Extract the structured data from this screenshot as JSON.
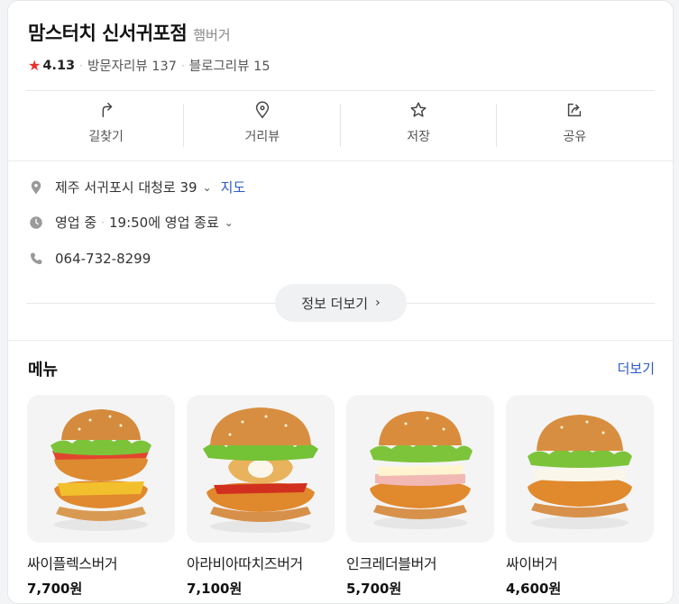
{
  "place": {
    "name": "맘스터치 신서귀포점",
    "category": "햄버거",
    "rating": "4.13",
    "visitor_reviews": "방문자리뷰 137",
    "blog_reviews": "블로그리뷰 15"
  },
  "actions": [
    {
      "label": "길찾기",
      "icon": "directions-icon"
    },
    {
      "label": "거리뷰",
      "icon": "location-pin-icon"
    },
    {
      "label": "저장",
      "icon": "star-outline-icon"
    },
    {
      "label": "공유",
      "icon": "share-icon"
    }
  ],
  "info": {
    "address": "제주 서귀포시 대청로 39",
    "map_link": "지도",
    "status": "영업 중",
    "hours": "19:50에 영업 종료",
    "phone": "064-732-8299",
    "more_button": "정보 더보기"
  },
  "menu": {
    "title": "메뉴",
    "more": "더보기",
    "items": [
      {
        "name": "싸이플렉스버거",
        "price": "7,700원"
      },
      {
        "name": "아라비아따치즈버거",
        "price": "7,100원"
      },
      {
        "name": "인크레더블버거",
        "price": "5,700원"
      },
      {
        "name": "싸이버거",
        "price": "4,600원"
      }
    ]
  },
  "colors": {
    "accent_link": "#2d59c8",
    "star": "#e8312c"
  }
}
